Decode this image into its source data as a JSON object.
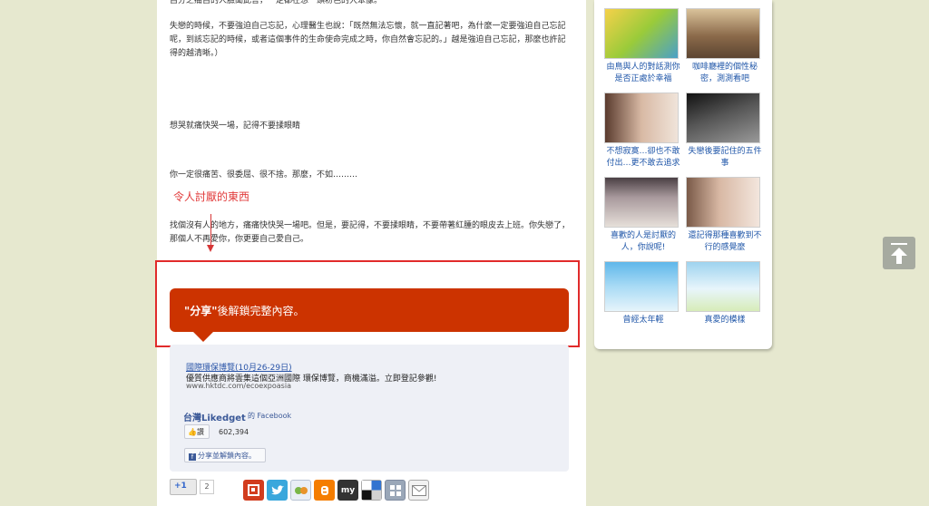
{
  "article": {
    "paragraphs": [
      "自分之痛自的人臉聞此言，一定都在想一頭粉色的大笨像。",
      "失戀的時候，不要強迫自己忘記，心理醫生也說：「既然無法忘懷，就一直記著吧，為什麼一定要強迫自己忘記呢，到該忘記的時候，或者這個事件的生命使命完成之時，你自然會忘記的。」越是強迫自己忘記，那麼也許記得的越清晰。）",
      "想哭就痛快哭一場，記得不要揉眼睛",
      "你一定很痛苦、很委屈、很不捨。那麼，不如………",
      "找個沒有人的地方，痛痛快快哭一場吧。但是，要記得，不要揉眼睛，不要帶著紅腫的眼皮去上班。你失戀了，那個人不再愛你，你更要自己愛自己。"
    ],
    "annotation_label": "令人討厭的東西"
  },
  "share_gate": {
    "bold": "\"分享\"",
    "rest": "後解鎖完整內容。"
  },
  "ad": {
    "link": "國際環保博覽(10月26-29日)",
    "desc": "優質供應商將雲集這個亞洲國際 環保博覽，商機滿溢。立即登記參觀!",
    "url": "www.hktdc.com/ecoexpoasia"
  },
  "facebook": {
    "page_name": "台灣Likedget",
    "suffix": "的 Facebook",
    "like_label": "讚",
    "like_count": "602,394",
    "share_label": "分享並解鎖內容。"
  },
  "social": {
    "gplus_label": "+1",
    "gplus_count": "2",
    "icons": [
      "plurk-icon",
      "twitter-icon",
      "yahoo-icon",
      "blogger-icon",
      "myspace-icon",
      "delicious-icon",
      "digg-icon",
      "email-icon"
    ],
    "myspace_label": "my"
  },
  "sidebar": {
    "tiles": [
      {
        "caption": "由鳥與人的對話測你是否正處於幸福",
        "colors": [
          "#f5d14a",
          "#4aa0c8"
        ]
      },
      {
        "caption": "咖啡廳裡的個性秘密，測測看吧",
        "colors": [
          "#5c4532",
          "#d9c29a"
        ]
      },
      {
        "caption": "不想寂寞…卻也不敢付出…更不敢去追求",
        "colors": [
          "#d8b9a4",
          "#5a3b2e"
        ]
      },
      {
        "caption": "失戀後要記住的五件事",
        "colors": [
          "#222222",
          "#777777"
        ]
      },
      {
        "caption": "喜歡的人是討厭的人，你說呢!",
        "colors": [
          "#4a3f44",
          "#e6dfd9"
        ]
      },
      {
        "caption": "還記得那種喜歡到不行的感覺麼",
        "colors": [
          "#f3e6dd",
          "#7a5a48"
        ]
      },
      {
        "caption": "曾經太年輕",
        "colors": [
          "#5fb7ea",
          "#e6f4fb"
        ]
      },
      {
        "caption": "真愛的模樣",
        "colors": [
          "#9ed3ef",
          "#d7ecb8"
        ]
      }
    ]
  },
  "colors": {
    "background": "#e6e8cf",
    "share_banner": "#cc3300",
    "highlight": "#e12b2b",
    "link": "#1f56a8"
  }
}
